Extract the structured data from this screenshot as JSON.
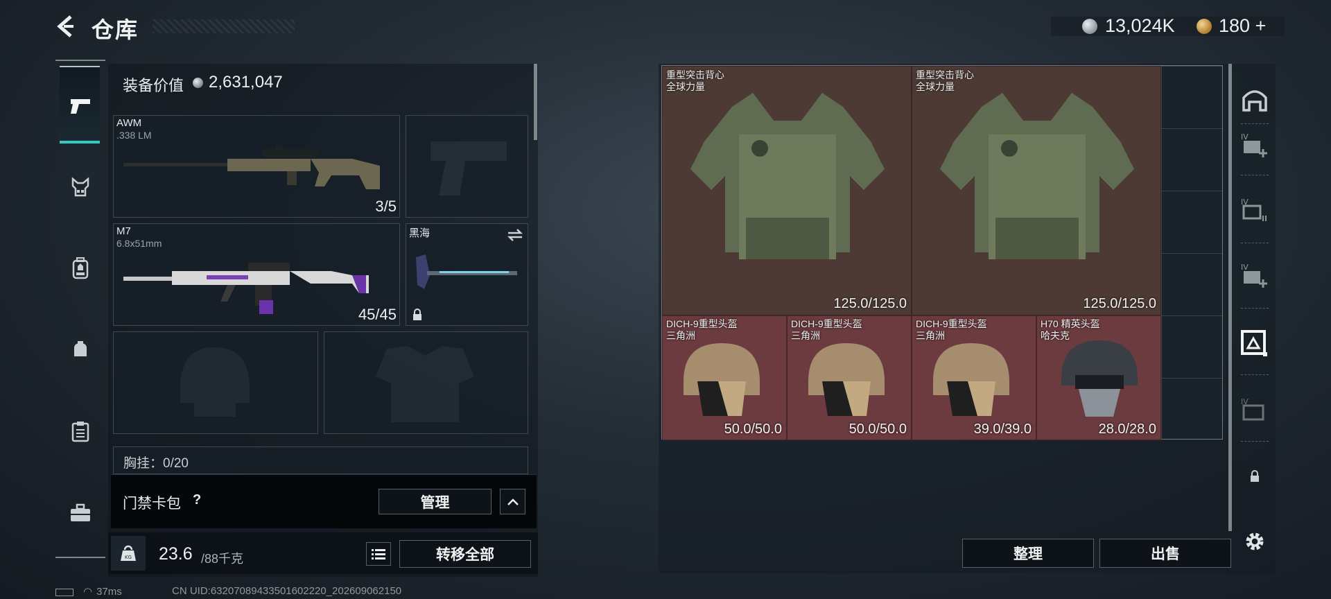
{
  "header": {
    "title": "仓库",
    "back_icon": "chevron-left-icon"
  },
  "currency": [
    {
      "icon": "silver-coin-icon",
      "value": "13,024K"
    },
    {
      "icon": "gold-coin-icon",
      "value": "180",
      "plus": "+"
    }
  ],
  "left_rail": [
    "pistol-icon",
    "vest-rig-icon",
    "backpack-icon",
    "backpack-small-icon",
    "clipboard-icon",
    "toolbox-icon"
  ],
  "loadout": {
    "value_label": "装备价值",
    "value_amount": "2,631,047",
    "primary": {
      "name": "AWM",
      "ammo": ".338 LM",
      "count": "3/5"
    },
    "secondary": {
      "name": "M7",
      "ammo": "6.8x51mm",
      "count": "45/45"
    },
    "melee": {
      "name": "黑海"
    },
    "chest_rig_label": "胸挂：0/20",
    "card_wallet": {
      "label": "门禁卡包",
      "help": "?",
      "manage": "管理"
    },
    "weight": {
      "current": "23.6",
      "max": "/88千克"
    },
    "transfer_all": "转移全部"
  },
  "storage": {
    "items": [
      {
        "id": "vest1",
        "name": "重型突击背心",
        "sub": "全球力量",
        "durability": "125.0/125.0"
      },
      {
        "id": "vest2",
        "name": "重型突击背心",
        "sub": "全球力量",
        "durability": "125.0/125.0"
      },
      {
        "id": "helm1",
        "name": "DICH-9重型头盔",
        "sub": "三角洲",
        "durability": "50.0/50.0"
      },
      {
        "id": "helm2",
        "name": "DICH-9重型头盔",
        "sub": "三角洲",
        "durability": "50.0/50.0"
      },
      {
        "id": "helm3",
        "name": "DICH-9重型头盔",
        "sub": "三角洲",
        "durability": "39.0/39.0"
      },
      {
        "id": "helm4",
        "name": "H70 精英头盔",
        "sub": "哈夫克",
        "durability": "28.0/28.0"
      }
    ],
    "tidy": "整理",
    "sell": "出售"
  },
  "right_rail": [
    "armor-stash-icon",
    "add-case-icon-1",
    "case-icon-2",
    "add-case-icon-3",
    "case-active-icon",
    "case-icon-5",
    "lock-icon",
    "settings-icon"
  ],
  "right_rail_labels": [
    "IV",
    "IV",
    "IV",
    "IV"
  ],
  "status": {
    "ping": "37ms",
    "uid": "CN UID:632070894335016022​20_202609062150"
  },
  "colors": {
    "accent": "#35c8c0",
    "vest_bg": "#4d3a35",
    "helmet_bg": "#6b3b3f"
  }
}
